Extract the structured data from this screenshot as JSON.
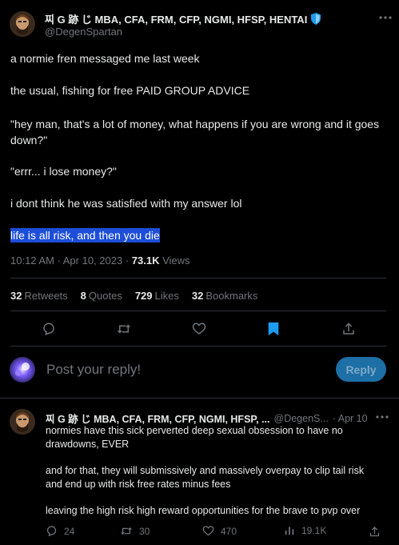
{
  "tweet": {
    "author_name": "찌 G 跡 じ MBA, CFA, FRM, CFP, NGMI, HFSP, HENTAI",
    "author_handle": "@DegenSpartan",
    "paragraphs": [
      "a normie fren messaged me last week",
      "the usual, fishing for free PAID GROUP ADVICE",
      "\"hey man, that's a lot of money, what happens if you are wrong and it goes down?\"",
      "\"errr... i lose money?\"",
      "i dont think he was satisfied with my answer lol"
    ],
    "highlighted_line": "life is all risk, and then you die",
    "timestamp": "10:12 AM · Apr 10, 2023 · ",
    "views_count": "73.1K",
    "views_label": " Views"
  },
  "stats": {
    "retweets_count": "32",
    "retweets_label": "Retweets",
    "quotes_count": "8",
    "quotes_label": "Quotes",
    "likes_count": "729",
    "likes_label": "Likes",
    "bookmarks_count": "32",
    "bookmarks_label": "Bookmarks"
  },
  "reply_composer": {
    "placeholder": "Post your reply!",
    "button_label": "Reply"
  },
  "reply": {
    "author_name": "찌 G 跡 じ MBA, CFA, FRM, CFP, NGMI, HFSP, ...",
    "author_handle": "@DegenS...",
    "date": "· Apr 10",
    "paragraphs": [
      "normies have this sick perverted deep sexual obsession to have no drawdowns, EVER",
      "and for that, they will submissively and massively overpay to clip tail risk and end up with risk free rates minus fees",
      "leaving the high risk high reward opportunities for the brave to pvp over"
    ],
    "actions": {
      "replies": "24",
      "retweets": "30",
      "likes": "470",
      "views": "19.1K"
    }
  },
  "colors": {
    "background": "#000000",
    "text": "#e7e9ea",
    "muted": "#71767b",
    "accent": "#1d9bf0",
    "selection": "#1d4ed8",
    "divider": "#2f3336"
  },
  "icons": [
    "more-icon",
    "verified-shield-icon",
    "reply-icon",
    "retweet-icon",
    "like-icon",
    "bookmark-icon",
    "share-icon",
    "views-icon"
  ]
}
